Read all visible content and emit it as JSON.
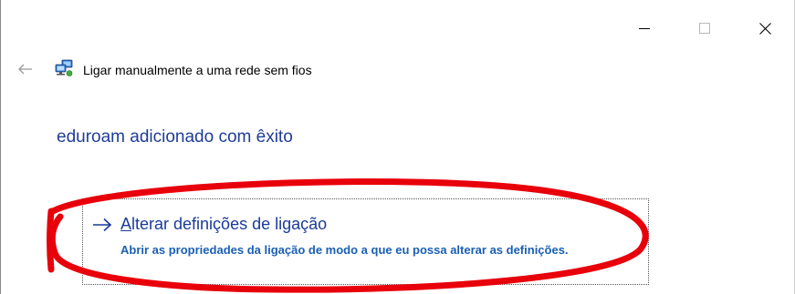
{
  "window": {
    "title": "Ligar manualmente a uma rede sem fios",
    "controls": {
      "minimize_icon": "minimize-icon",
      "maximize_icon": "maximize-icon",
      "close_icon": "close-icon"
    },
    "back_icon": "back-arrow-icon",
    "network_icon": "network-connection-icon"
  },
  "content": {
    "heading": "eduroam adicionado com êxito",
    "command_link": {
      "arrow_icon": "right-arrow-icon",
      "title_access_key": "A",
      "title_rest": "lterar definições de ligação",
      "description": "Abrir as propriedades da ligação de modo a que eu possa alterar as definições."
    }
  },
  "colors": {
    "heading": "#1f3d99",
    "link_title": "#1a3a9c",
    "link_description": "#1a5fb4",
    "annotation": "#e8000b"
  },
  "annotation": {
    "shape": "ellipse-highlight"
  }
}
